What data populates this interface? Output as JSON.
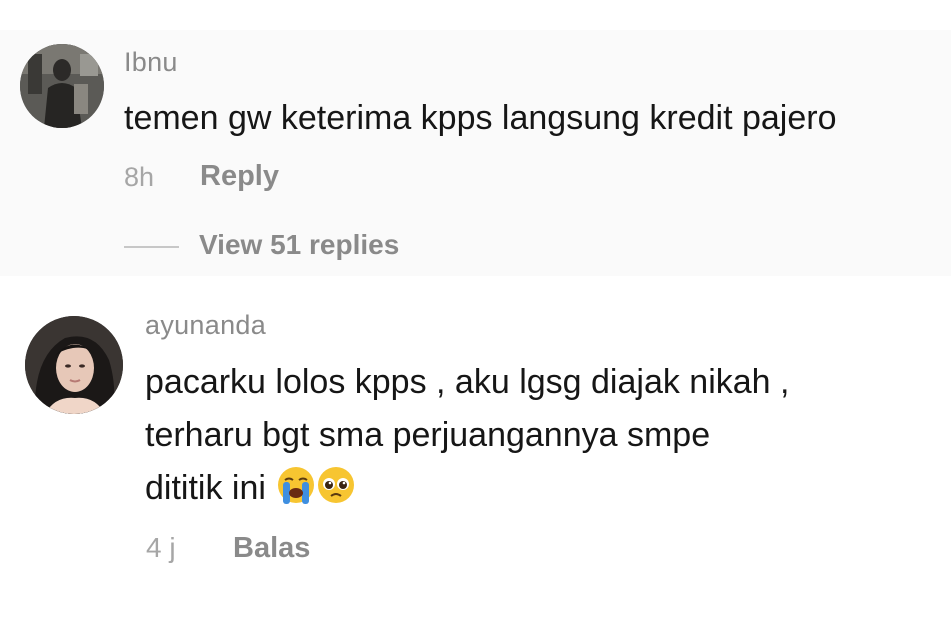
{
  "comments": [
    {
      "username": "Ibnu",
      "text": "temen gw keterima kpps langsung kredit pajero",
      "time": "8h",
      "reply_label": "Reply",
      "view_replies_label": "View 51 replies"
    },
    {
      "username": "ayunanda",
      "lines": [
        "pacarku lolos kpps , aku lgsg diajak nikah ,",
        "terharu bgt sma perjuangannya smpe",
        "dititik ini"
      ],
      "emojis": [
        "loudly-crying-face-icon",
        "pleading-face-icon"
      ],
      "time": "4 j",
      "reply_label": "Balas"
    }
  ]
}
